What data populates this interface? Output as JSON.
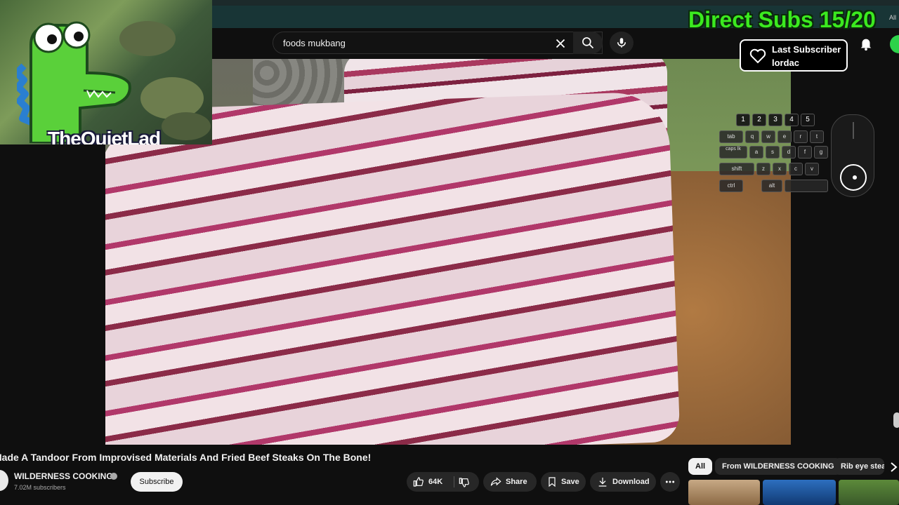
{
  "overlay": {
    "direct_subs": "Direct Subs 15/20",
    "cam_label": "TheQuietLad",
    "last_subscriber_title": "Last Subscriber",
    "last_subscriber_name": "lordac",
    "keys_numbers": [
      "1",
      "2",
      "3",
      "4",
      "5"
    ],
    "keys_row1": [
      "tab",
      "q",
      "w",
      "e",
      "r",
      "t"
    ],
    "keys_row2": [
      "caps lk",
      "a",
      "s",
      "d",
      "f",
      "g"
    ],
    "keys_row3": [
      "shift",
      "z",
      "x",
      "c",
      "v"
    ],
    "keys_row4": [
      "ctrl",
      "alt"
    ]
  },
  "topbar": {
    "all_label": "All"
  },
  "header": {
    "search_query": "foods mukbang"
  },
  "video": {
    "title": "Made A Tandoor From Improvised Materials And Fried Beef Steaks On The Bone!",
    "channel_name": "WILDERNESS COOKING",
    "channel_subs": "7.02M subscribers",
    "subscribe_label": "Subscribe",
    "like_count": "64K",
    "share_label": "Share",
    "save_label": "Save",
    "download_label": "Download"
  },
  "chips": [
    "All",
    "From WILDERNESS COOKING",
    "Rib eye steak"
  ],
  "colors": {
    "subs_green": "#3bea1f",
    "background": "#0f0f0f",
    "pill": "#272727"
  }
}
